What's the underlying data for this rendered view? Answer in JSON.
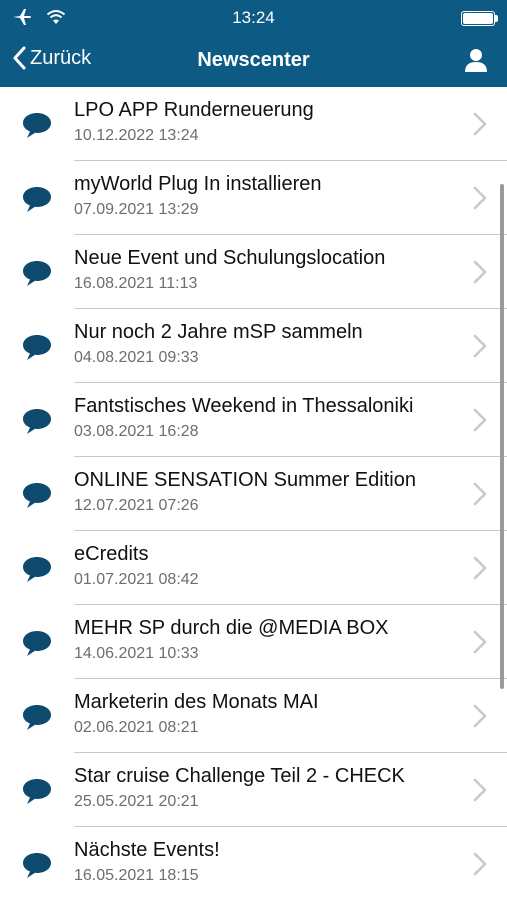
{
  "status": {
    "time": "13:24"
  },
  "nav": {
    "back_label": "Zurück",
    "title": "Newscenter"
  },
  "news": [
    {
      "title": "LPO APP Runderneuerung",
      "date": "10.12.2022 13:24"
    },
    {
      "title": "myWorld Plug In installieren",
      "date": "07.09.2021 13:29"
    },
    {
      "title": "Neue Event und Schulungslocation",
      "date": "16.08.2021 11:13"
    },
    {
      "title": "Nur noch 2 Jahre mSP sammeln",
      "date": "04.08.2021 09:33"
    },
    {
      "title": "Fantstisches Weekend in Thessaloniki",
      "date": "03.08.2021 16:28"
    },
    {
      "title": "ONLINE SENSATION Summer Edition",
      "date": "12.07.2021 07:26"
    },
    {
      "title": "eCredits",
      "date": "01.07.2021 08:42"
    },
    {
      "title": "MEHR SP durch die @MEDIA BOX",
      "date": "14.06.2021 10:33"
    },
    {
      "title": "Marketerin des Monats MAI",
      "date": "02.06.2021 08:21"
    },
    {
      "title": "Star cruise Challenge Teil 2 - CHECK",
      "date": "25.05.2021 20:21"
    },
    {
      "title": "Nächste Events!",
      "date": "16.05.2021 18:15"
    }
  ],
  "icons": {
    "list_item": "speech-bubble-icon",
    "row_chevron": "chevron-right-icon",
    "profile": "user-icon"
  },
  "colors": {
    "header": "#0d5a84",
    "icon": "#0d4a6e",
    "date": "#6d6d72"
  }
}
